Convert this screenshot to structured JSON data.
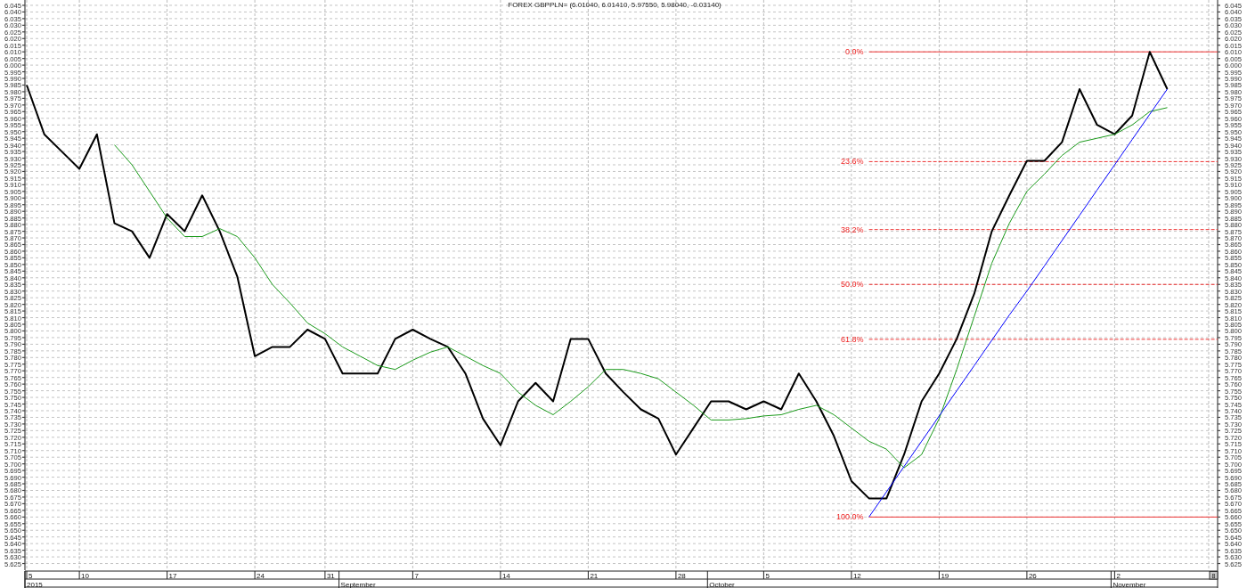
{
  "chart": {
    "chart_data": {
      "type": "line",
      "title": "FOREX GBPPLN= (6.01040, 6.01410, 5.97550, 5.98040, -0.03140)",
      "categories": [
        "5",
        null,
        null,
        "10",
        null,
        null,
        null,
        null,
        "17",
        null,
        null,
        null,
        null,
        "24",
        null,
        null,
        null,
        "31",
        null,
        null,
        null,
        null,
        "7",
        null,
        null,
        null,
        null,
        "14",
        null,
        null,
        null,
        null,
        "21",
        null,
        null,
        null,
        null,
        "28",
        null,
        null,
        null,
        null,
        "5",
        null,
        null,
        null,
        null,
        "12",
        null,
        null,
        null,
        null,
        "19",
        null,
        null,
        null,
        null,
        "26",
        null,
        null,
        null,
        null,
        "2",
        null,
        null,
        null
      ],
      "series": [
        {
          "color": "#000000",
          "values": [
            5.985,
            5.948,
            5.935,
            5.922,
            5.948,
            5.881,
            5.875,
            5.855,
            5.888,
            5.875,
            5.902,
            5.875,
            5.841,
            5.781,
            5.788,
            5.788,
            5.801,
            5.794,
            5.768,
            5.768,
            5.768,
            5.794,
            5.801,
            5.794,
            5.788,
            5.768,
            5.734,
            5.714,
            5.747,
            5.761,
            5.747,
            5.794,
            5.794,
            5.768,
            5.754,
            5.741,
            5.734,
            5.707,
            5.727,
            5.747,
            5.747,
            5.741,
            5.747,
            5.741,
            5.768,
            5.747,
            5.721,
            5.687,
            5.674,
            5.674,
            5.707,
            5.747,
            5.768,
            5.794,
            5.828,
            5.875,
            5.902,
            5.928,
            5.928,
            5.942,
            5.982,
            5.955,
            5.948,
            5.962,
            6.01,
            5.982
          ]
        },
        {
          "color": "#1a9a1a",
          "values": [
            null,
            null,
            null,
            null,
            null,
            5.94,
            5.925,
            5.905,
            5.885,
            5.871,
            5.871,
            5.877,
            5.871,
            5.855,
            5.835,
            5.821,
            5.806,
            5.798,
            5.788,
            5.781,
            5.774,
            5.771,
            5.778,
            5.784,
            5.788,
            5.781,
            5.774,
            5.768,
            5.754,
            5.744,
            5.737,
            5.747,
            5.758,
            5.771,
            5.771,
            5.768,
            5.764,
            5.754,
            5.744,
            5.733,
            5.733,
            5.734,
            5.736,
            5.737,
            5.741,
            5.744,
            5.737,
            5.727,
            5.717,
            5.711,
            5.697,
            5.707,
            5.734,
            5.771,
            5.811,
            5.851,
            5.881,
            5.905,
            5.918,
            5.932,
            5.942,
            5.945,
            5.948,
            5.955,
            5.965,
            5.968
          ]
        },
        {
          "color": "#0000ff",
          "values": [
            null,
            null,
            null,
            null,
            null,
            null,
            null,
            null,
            null,
            null,
            null,
            null,
            null,
            null,
            null,
            null,
            null,
            null,
            null,
            null,
            null,
            null,
            null,
            null,
            null,
            null,
            null,
            null,
            null,
            null,
            null,
            null,
            null,
            null,
            null,
            null,
            null,
            null,
            null,
            null,
            null,
            null,
            null,
            null,
            null,
            null,
            null,
            null,
            5.66,
            5.679,
            5.698,
            5.717,
            5.736,
            5.755,
            5.774,
            5.793,
            5.812,
            5.83,
            5.849,
            5.868,
            5.887,
            5.906,
            5.925,
            5.944,
            5.963,
            5.982
          ]
        }
      ],
      "ylim": [
        5.62,
        6.049
      ],
      "yticks": [
        {
          "value": 6.045,
          "label": "6.045"
        },
        {
          "value": 6.04,
          "label": "6.040"
        },
        {
          "value": 6.035,
          "label": "6.035"
        },
        {
          "value": 6.03,
          "label": "6.030"
        },
        {
          "value": 6.025,
          "label": "6.025"
        },
        {
          "value": 6.02,
          "label": "6.020"
        },
        {
          "value": 6.015,
          "label": "6.015"
        },
        {
          "value": 6.01,
          "label": "6.010"
        },
        {
          "value": 6.005,
          "label": "6.005"
        },
        {
          "value": 6,
          "label": "6.000"
        },
        {
          "value": 5.995,
          "label": "5.995"
        },
        {
          "value": 5.99,
          "label": "5.990"
        },
        {
          "value": 5.985,
          "label": "5.985"
        },
        {
          "value": 5.98,
          "label": "5.980"
        },
        {
          "value": 5.975,
          "label": "5.975"
        },
        {
          "value": 5.97,
          "label": "5.970"
        },
        {
          "value": 5.965,
          "label": "5.965"
        },
        {
          "value": 5.96,
          "label": "5.960"
        },
        {
          "value": 5.955,
          "label": "5.955"
        },
        {
          "value": 5.95,
          "label": "5.950"
        },
        {
          "value": 5.945,
          "label": "5.945"
        },
        {
          "value": 5.94,
          "label": "5.940"
        },
        {
          "value": 5.935,
          "label": "5.935"
        },
        {
          "value": 5.93,
          "label": "5.930"
        },
        {
          "value": 5.925,
          "label": "5.925"
        },
        {
          "value": 5.92,
          "label": "5.920"
        },
        {
          "value": 5.915,
          "label": "5.915"
        },
        {
          "value": 5.91,
          "label": "5.910"
        },
        {
          "value": 5.905,
          "label": "5.905"
        },
        {
          "value": 5.9,
          "label": "5.900"
        },
        {
          "value": 5.895,
          "label": "5.895"
        },
        {
          "value": 5.89,
          "label": "5.890"
        },
        {
          "value": 5.885,
          "label": "5.885"
        },
        {
          "value": 5.88,
          "label": "5.880"
        },
        {
          "value": 5.875,
          "label": "5.875"
        },
        {
          "value": 5.87,
          "label": "5.870"
        },
        {
          "value": 5.865,
          "label": "5.865"
        },
        {
          "value": 5.86,
          "label": "5.860"
        },
        {
          "value": 5.855,
          "label": "5.855"
        },
        {
          "value": 5.85,
          "label": "5.850"
        },
        {
          "value": 5.845,
          "label": "5.845"
        },
        {
          "value": 5.84,
          "label": "5.840"
        },
        {
          "value": 5.835,
          "label": "5.835"
        },
        {
          "value": 5.83,
          "label": "5.830"
        },
        {
          "value": 5.825,
          "label": "5.825"
        },
        {
          "value": 5.82,
          "label": "5.820"
        },
        {
          "value": 5.815,
          "label": "5.815"
        },
        {
          "value": 5.81,
          "label": "5.810"
        },
        {
          "value": 5.805,
          "label": "5.805"
        },
        {
          "value": 5.8,
          "label": "5.800"
        },
        {
          "value": 5.795,
          "label": "5.795"
        },
        {
          "value": 5.79,
          "label": "5.790"
        },
        {
          "value": 5.785,
          "label": "5.785"
        },
        {
          "value": 5.78,
          "label": "5.780"
        },
        {
          "value": 5.775,
          "label": "5.775"
        },
        {
          "value": 5.77,
          "label": "5.770"
        },
        {
          "value": 5.765,
          "label": "5.765"
        },
        {
          "value": 5.76,
          "label": "5.760"
        },
        {
          "value": 5.755,
          "label": "5.755"
        },
        {
          "value": 5.75,
          "label": "5.750"
        },
        {
          "value": 5.745,
          "label": "5.745"
        },
        {
          "value": 5.74,
          "label": "5.740"
        },
        {
          "value": 5.735,
          "label": "5.735"
        },
        {
          "value": 5.73,
          "label": "5.730"
        },
        {
          "value": 5.725,
          "label": "5.725"
        },
        {
          "value": 5.72,
          "label": "5.720"
        },
        {
          "value": 5.715,
          "label": "5.715"
        },
        {
          "value": 5.71,
          "label": "5.710"
        },
        {
          "value": 5.705,
          "label": "5.705"
        },
        {
          "value": 5.7,
          "label": "5.700"
        },
        {
          "value": 5.695,
          "label": "5.695"
        },
        {
          "value": 5.69,
          "label": "5.690"
        },
        {
          "value": 5.685,
          "label": "5.685"
        },
        {
          "value": 5.68,
          "label": "5.680"
        },
        {
          "value": 5.675,
          "label": "5.675"
        },
        {
          "value": 5.67,
          "label": "5.670"
        },
        {
          "value": 5.665,
          "label": "5.665"
        },
        {
          "value": 5.66,
          "label": "5.660"
        },
        {
          "value": 5.655,
          "label": "5.655"
        },
        {
          "value": 5.65,
          "label": "5.650"
        },
        {
          "value": 5.645,
          "label": "5.645"
        },
        {
          "value": 5.64,
          "label": "5.640"
        },
        {
          "value": 5.635,
          "label": "5.635"
        },
        {
          "value": 5.63,
          "label": "5.630"
        },
        {
          "value": 5.625,
          "label": "5.625"
        }
      ],
      "grid": true,
      "annotations": [
        "0.0%",
        "23.6%",
        "38.2%",
        "50.0%",
        "61.8%",
        "100.0%"
      ]
    },
    "right_axis_labels": [
      "6.045",
      "6.040",
      "6.035",
      "6.030",
      "6.025",
      "6.020",
      "6.015",
      "6.010",
      "6.005",
      "6.000",
      "5.995",
      "5.990",
      "5.985",
      "5.980",
      "5.975",
      "5.970",
      "5.965",
      "5.960",
      "5.955",
      "5.950",
      "5.945",
      "5.940",
      "5.935",
      "5.930",
      "5.925",
      "5.920",
      "5.915",
      "5.910",
      "5.905",
      "5.900",
      "5.895",
      "5.890",
      "5.885",
      "5.880",
      "5.875",
      "5.870",
      "5.865",
      "5.860",
      "5.855",
      "5.850",
      "5.845",
      "5.840",
      "5.835",
      "5.830",
      "5.825",
      "5.820",
      "5.815",
      "5.810",
      "5.805",
      "5.800",
      "5.795",
      "5.790",
      "5.785",
      "5.780",
      "5.775",
      "5.770",
      "5.765",
      "5.760",
      "5.755",
      "5.750",
      "5.745",
      "5.740",
      "5.735",
      "5.730",
      "5.725",
      "5.720",
      "5.715",
      "5.710",
      "5.705",
      "5.700",
      "5.695",
      "5.690",
      "5.685",
      "5.680",
      "5.675",
      "5.670",
      "5.665",
      "5.660",
      "5.655",
      "5.650",
      "5.645",
      "5.640",
      "5.635",
      "5.630",
      "5.625"
    ],
    "periods": [
      "2015",
      "September",
      "October",
      "November"
    ],
    "corner_button": {
      "label": "8"
    }
  }
}
